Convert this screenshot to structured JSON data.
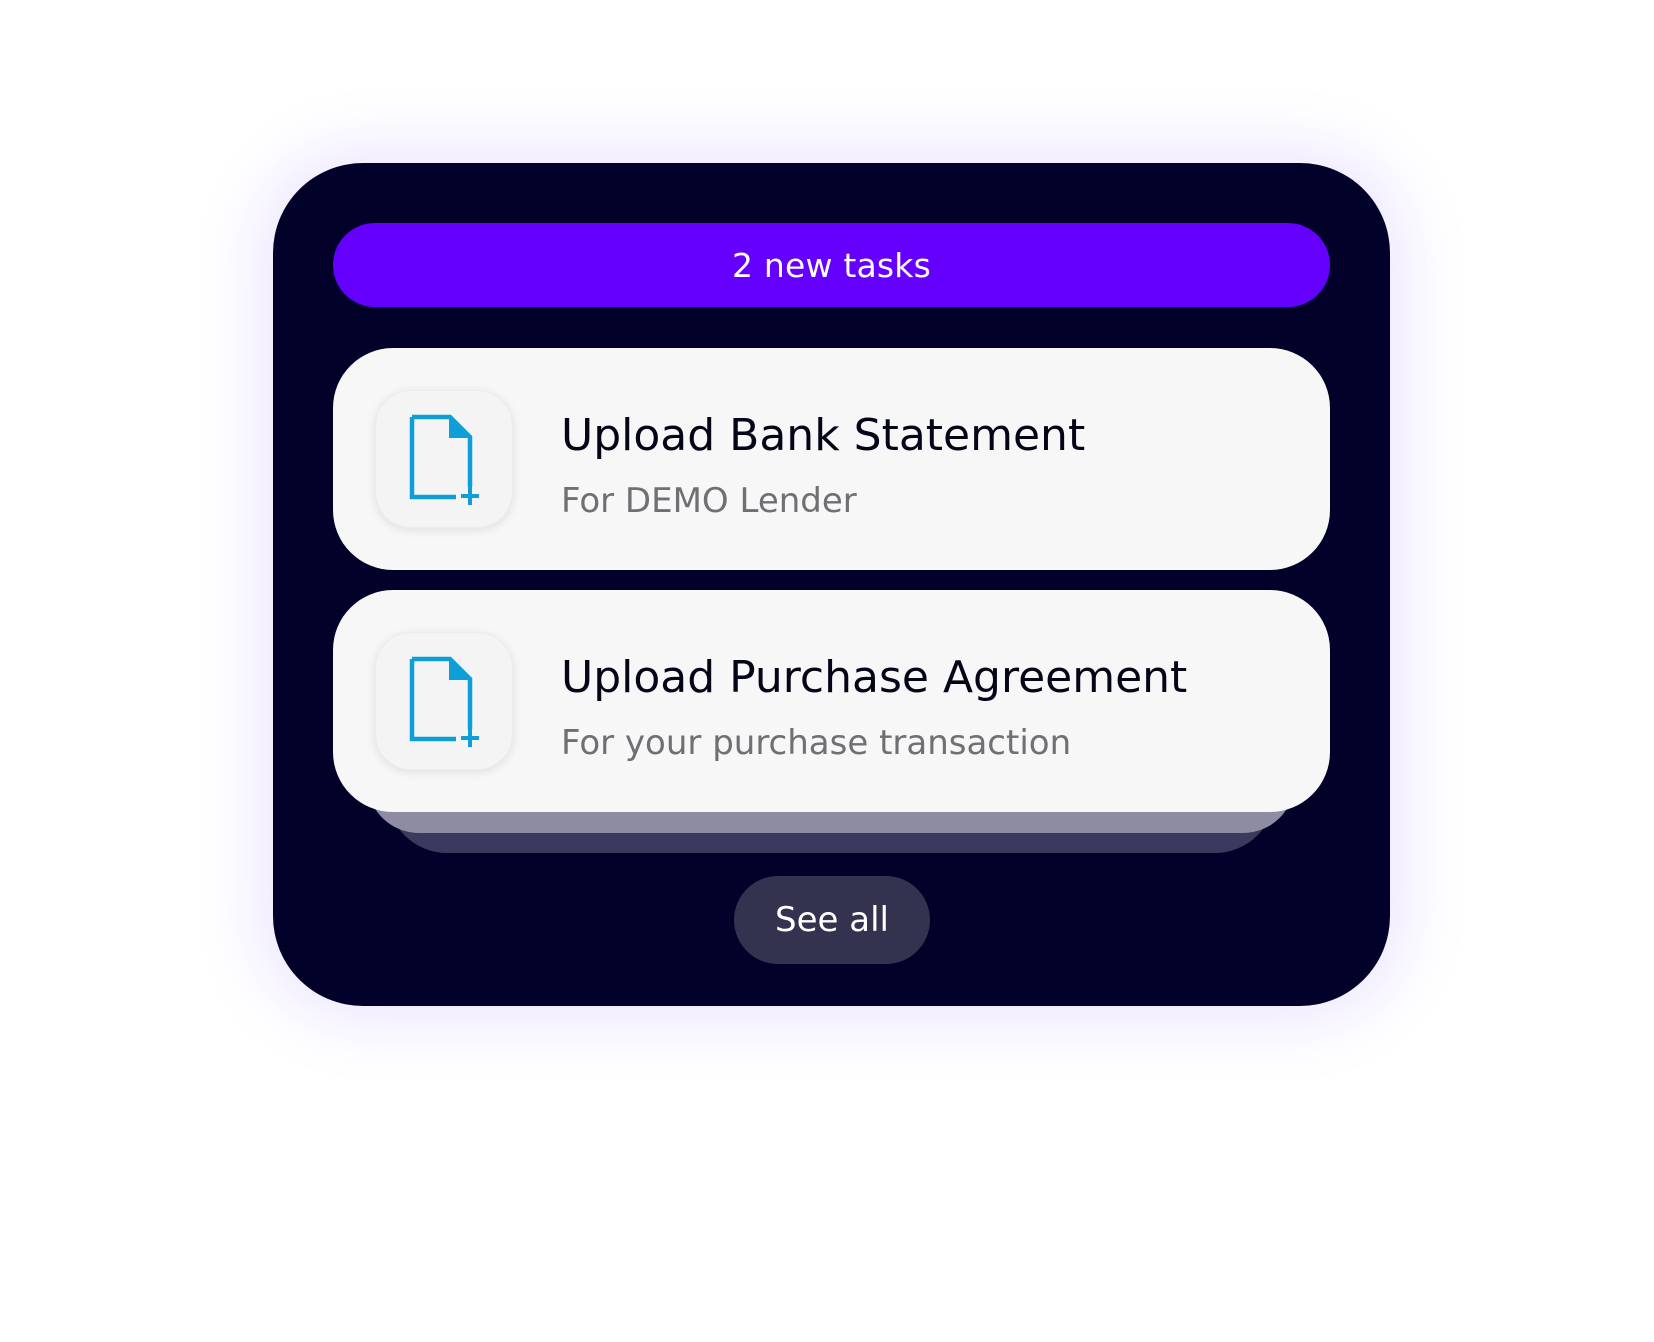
{
  "tasks_widget": {
    "banner_label": "2 new tasks",
    "tasks": [
      {
        "title": "Upload Bank Statement",
        "subtitle": "For DEMO Lender",
        "icon": "document-add-icon"
      },
      {
        "title": "Upload Purchase Agreement",
        "subtitle": "For your purchase transaction",
        "icon": "document-add-icon"
      }
    ],
    "see_all_label": "See all"
  },
  "colors": {
    "card_background": "#01012a",
    "banner_background": "#6500fe",
    "task_background": "#f7f7f7",
    "icon_color": "#0e9fd9",
    "see_all_background": "#33334f"
  }
}
